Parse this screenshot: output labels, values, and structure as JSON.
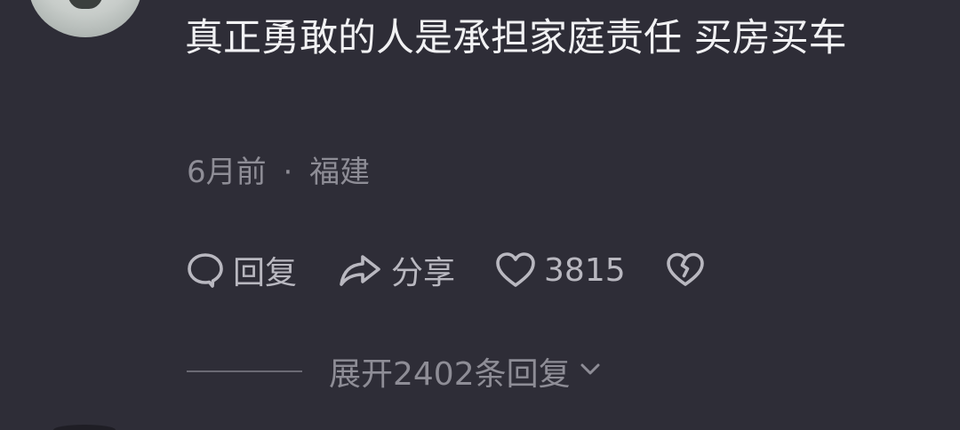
{
  "comment": {
    "text": "真正勇敢的人是承担家庭责任 买房买车",
    "time": "6月前",
    "separator": "·",
    "location": "福建"
  },
  "actions": {
    "reply_label": "回复",
    "share_label": "分享",
    "like_count": "3815"
  },
  "replies": {
    "expand_label": "展开2402条回复"
  },
  "icons": {
    "reply": "comment-bubble-icon",
    "share": "share-arrow-icon",
    "like": "heart-icon",
    "dislike": "broken-heart-icon",
    "expand": "chevron-down-icon"
  },
  "colors": {
    "background": "#2e2d37",
    "primary_text": "#f1f1f3",
    "secondary_text": "#8e8d96",
    "action_text": "#b9b8c0"
  }
}
